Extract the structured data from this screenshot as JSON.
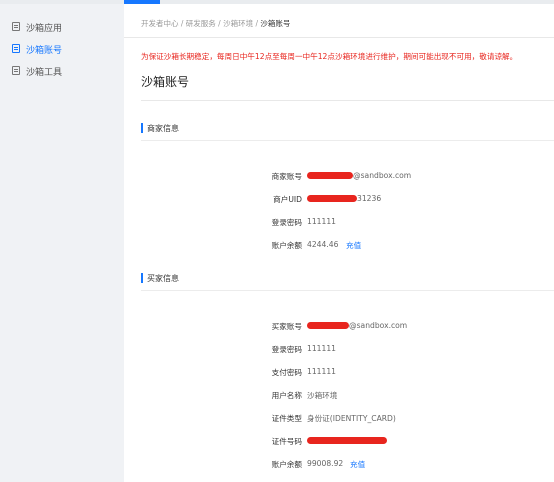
{
  "sidebar": {
    "items": [
      {
        "label": "沙箱应用",
        "icon": "document-icon"
      },
      {
        "label": "沙箱账号",
        "icon": "document-icon",
        "active": true
      },
      {
        "label": "沙箱工具",
        "icon": "document-icon"
      }
    ]
  },
  "breadcrumb": {
    "items": [
      "开发者中心",
      "研发服务",
      "沙箱环境",
      "沙箱账号"
    ],
    "separator": " / "
  },
  "notice": "为保证沙箱长期稳定，每周日中午12点至每周一中午12点沙箱环境进行维护，期间可能出现不可用，敬请谅解。",
  "page_title": "沙箱账号",
  "merchant": {
    "section_title": "商家信息",
    "account_label": "商家账号",
    "account_suffix": "@sandbox.com",
    "uid_label": "商户UID",
    "uid_suffix": "31236",
    "password_label": "登录密码",
    "password_value": "111111",
    "balance_label": "账户余额",
    "balance_value": "4244.46",
    "recharge_label": "充值"
  },
  "buyer": {
    "section_title": "买家信息",
    "account_label": "买家账号",
    "account_suffix": "@sandbox.com",
    "login_password_label": "登录密码",
    "login_password_value": "111111",
    "pay_password_label": "支付密码",
    "pay_password_value": "111111",
    "username_label": "用户名称",
    "username_value": "沙箱环境",
    "cert_type_label": "证件类型",
    "cert_type_value": "身份证(IDENTITY_CARD)",
    "cert_no_label": "证件号码",
    "balance_label": "账户余额",
    "balance_value": "99008.92",
    "recharge_label": "充值"
  },
  "colors": {
    "accent": "#1677ff",
    "notice": "#e8251e",
    "redaction": "#e8251e",
    "sidebar_bg": "#f0f2f5"
  }
}
